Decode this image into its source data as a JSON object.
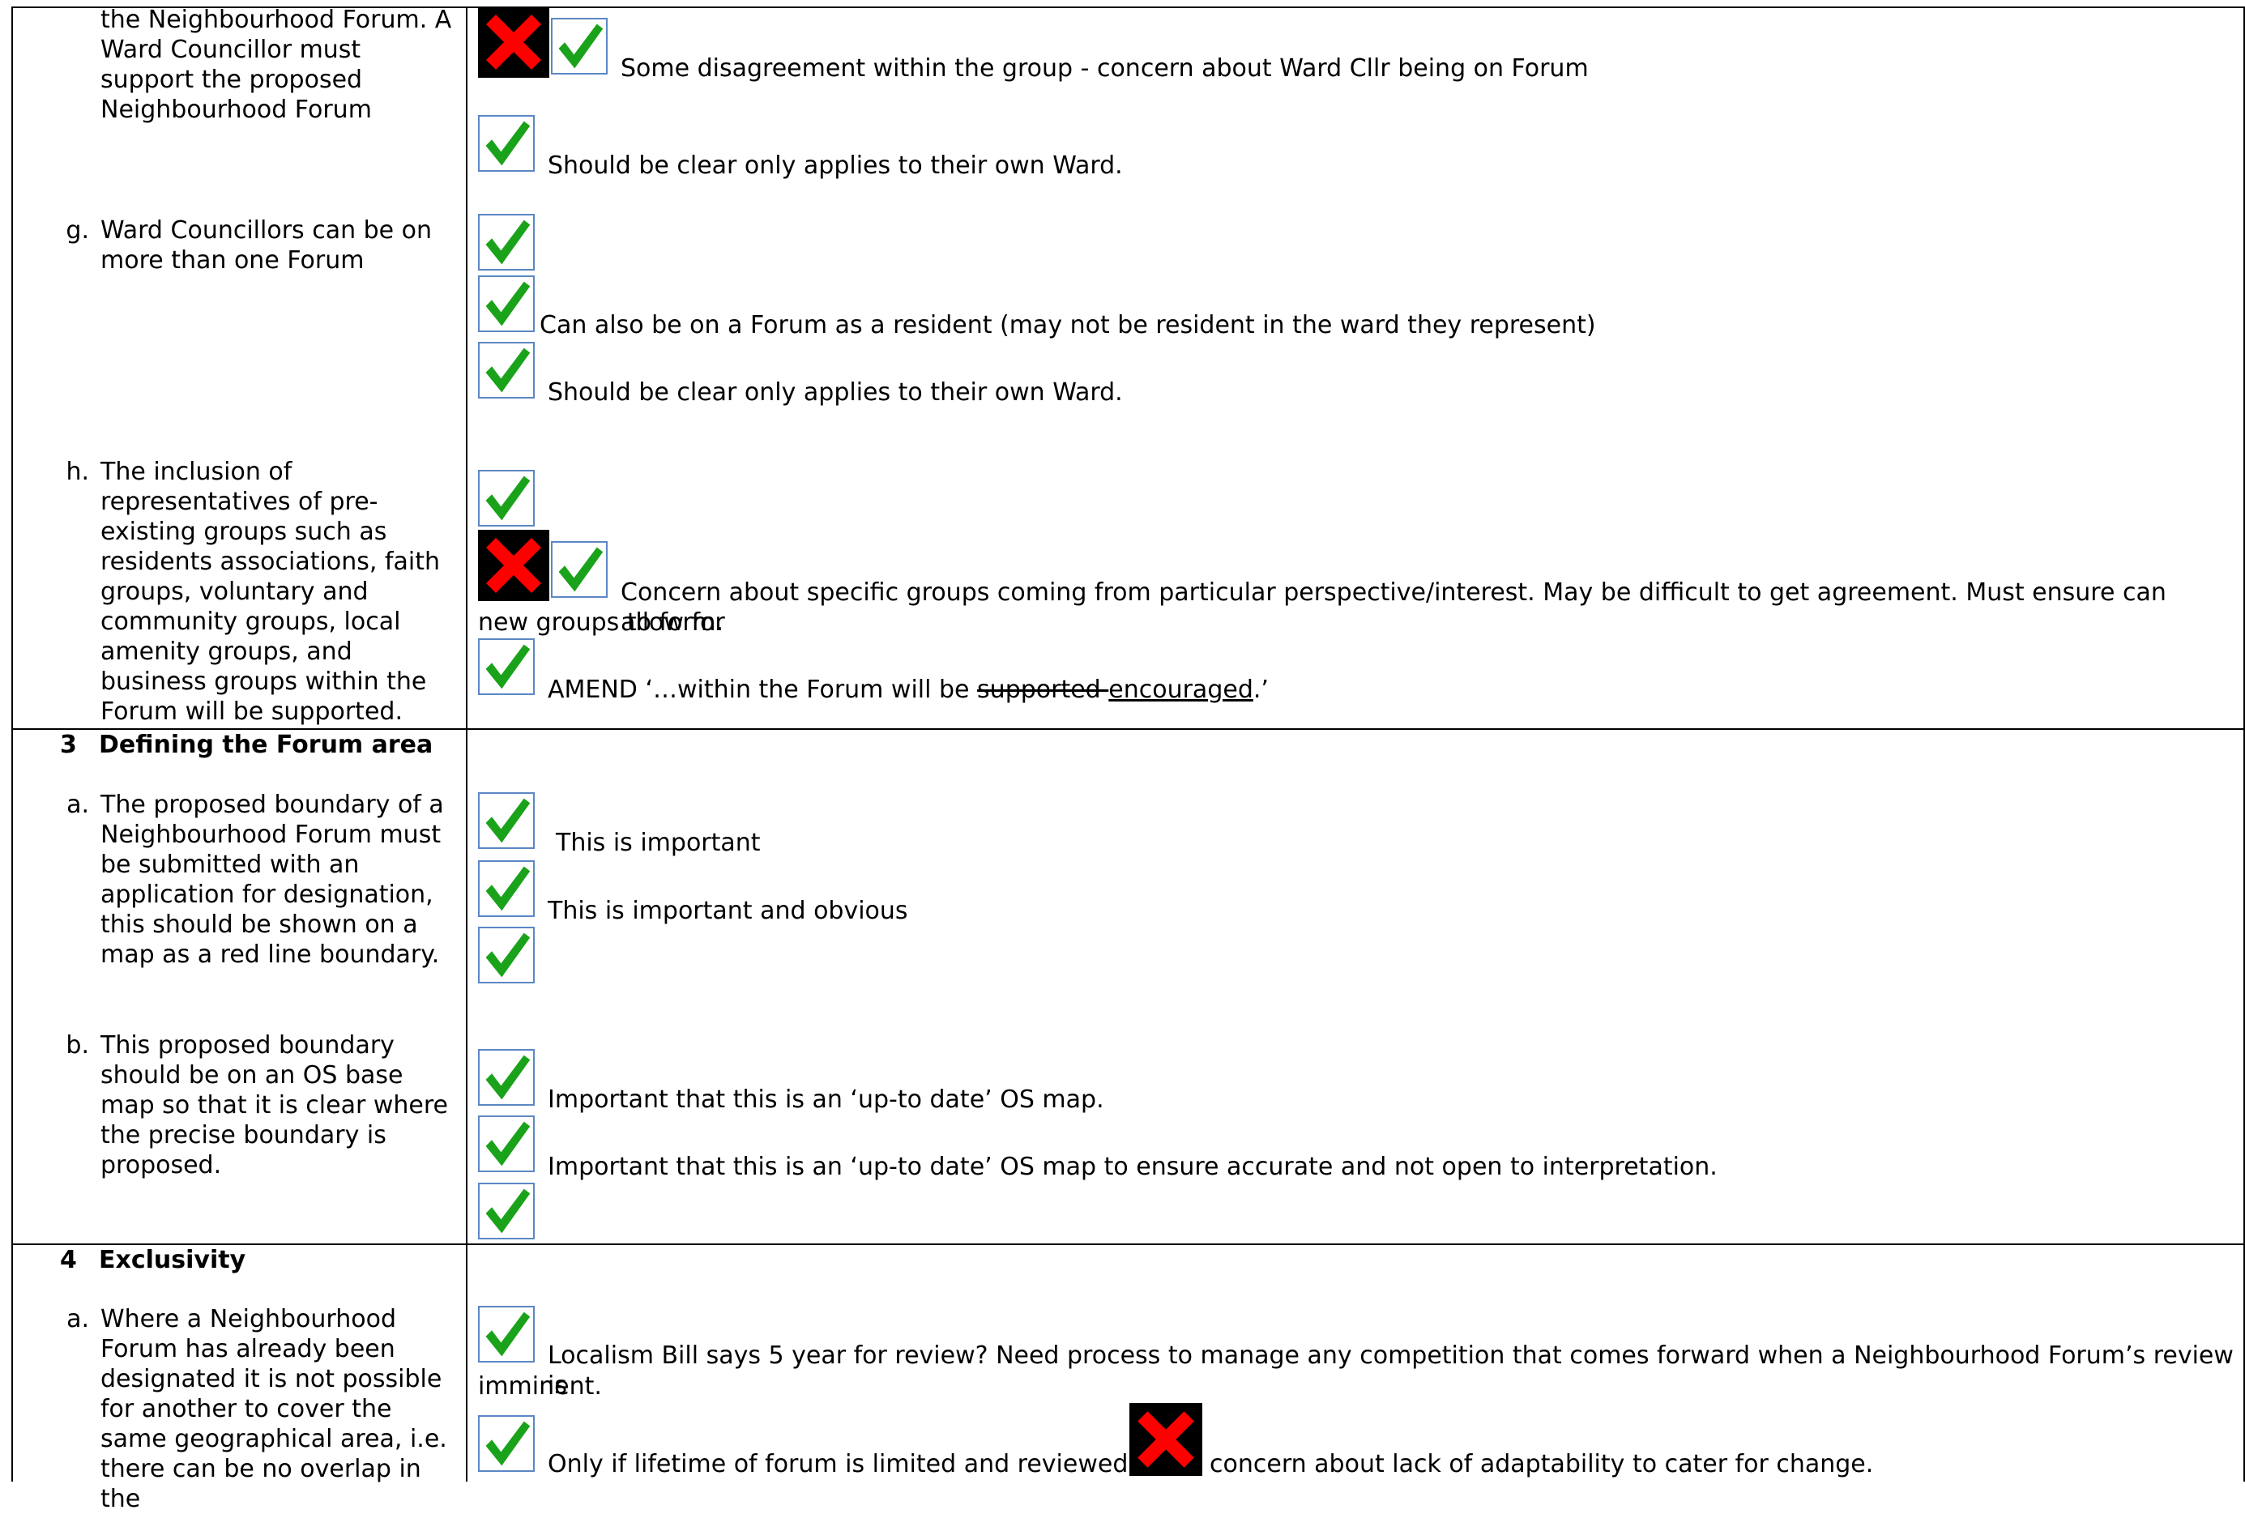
{
  "section2": {
    "f_tail": "the Neighbourhood Forum. A Ward Councillor must support the proposed Neighbourhood Forum",
    "f_comments": [
      "Some disagreement within the group - concern about Ward Cllr being on Forum",
      "Should be clear only applies to their own Ward."
    ],
    "g": {
      "letter": "g.",
      "text": "Ward Councillors can be on more than one Forum"
    },
    "g_comments": [
      "Can also be on a Forum as a resident (may not be resident in the ward they represent)",
      "Should be clear only applies to their own Ward."
    ],
    "h": {
      "letter": "h.",
      "text": "The inclusion of representatives of pre-existing groups such as residents associations, faith groups, voluntary and community groups, local amenity groups, and business groups within the Forum will be supported."
    },
    "h_comment_1_line1": "Concern about specific groups coming from particular perspective/interest. May be difficult to get agreement. Must ensure can allow for",
    "h_comment_1_line2": "new groups to form.",
    "h_amend_prefix": "AMEND ‘…within the Forum will be ",
    "h_amend_struck": "supported ",
    "h_amend_inserted": "encouraged",
    "h_amend_suffix": ".’"
  },
  "section3": {
    "number": "3",
    "title": "Defining the Forum area",
    "a": {
      "letter": "a.",
      "text": "The proposed boundary of a Neighbourhood Forum must be submitted with an application for designation, this should be shown on a map as a red line boundary."
    },
    "a_comments": [
      "This is important",
      "This is important and obvious"
    ],
    "b": {
      "letter": "b.",
      "text": "This proposed boundary should be on an OS base map so that it is clear where the precise boundary is proposed."
    },
    "b_comments": [
      "Important that this is an ‘up-to date’ OS map.",
      "Important that this is an ‘up-to date’ OS map to ensure accurate and not open to interpretation."
    ]
  },
  "section4": {
    "number": "4",
    "title": "Exclusivity",
    "a": {
      "letter": "a.",
      "text": "Where a Neighbourhood Forum has already been designated it is not possible for another to cover the same geographical area, i.e. there can be no overlap in the"
    },
    "a_comment_1_line1": "Localism Bill says 5 year for review? Need process to manage any competition that comes forward when a Neighbourhood Forum’s review is",
    "a_comment_1_line2": "imminent.",
    "a_comment_2_part1": "Only if lifetime of forum is limited and reviewed",
    "a_comment_2_part2": "concern about lack of adaptability to cater for change."
  },
  "icons": {
    "tick": "check-mark-icon",
    "cross": "cross-mark-icon",
    "tick_color": "#1aa31a",
    "cross_color": "#ff0000",
    "box_border_color": "#5b87c4"
  }
}
